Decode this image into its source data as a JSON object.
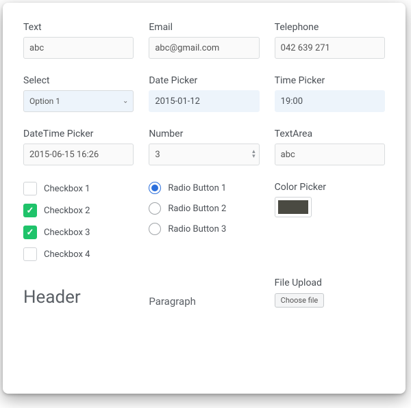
{
  "row1": {
    "text": {
      "label": "Text",
      "value": "abc"
    },
    "email": {
      "label": "Email",
      "value": "abc@gmail.com"
    },
    "tel": {
      "label": "Telephone",
      "value": "042 639 271"
    }
  },
  "row2": {
    "select": {
      "label": "Select",
      "value": "Option 1"
    },
    "date": {
      "label": "Date Picker",
      "value": "2015-01-12"
    },
    "time": {
      "label": "Time Picker",
      "value": "19:00"
    }
  },
  "row3": {
    "datetime": {
      "label": "DateTime Picker",
      "value": "2015-06-15 16:26"
    },
    "number": {
      "label": "Number",
      "value": "3"
    },
    "textarea": {
      "label": "TextArea",
      "value": "abc"
    }
  },
  "checkboxes": [
    {
      "label": "Checkbox 1",
      "checked": false
    },
    {
      "label": "Checkbox 2",
      "checked": true
    },
    {
      "label": "Checkbox 3",
      "checked": true
    },
    {
      "label": "Checkbox 4",
      "checked": false
    }
  ],
  "radios": {
    "options": [
      {
        "label": "Radio Button 1",
        "selected": true
      },
      {
        "label": "Radio Button 2",
        "selected": false
      },
      {
        "label": "Radio Button 3",
        "selected": false
      }
    ]
  },
  "color_picker": {
    "label": "Color Picker",
    "value": "#4a4a42"
  },
  "header_text": "Header",
  "paragraph_text": "Paragraph",
  "file_upload": {
    "label": "File Upload",
    "button": "Choose file"
  }
}
